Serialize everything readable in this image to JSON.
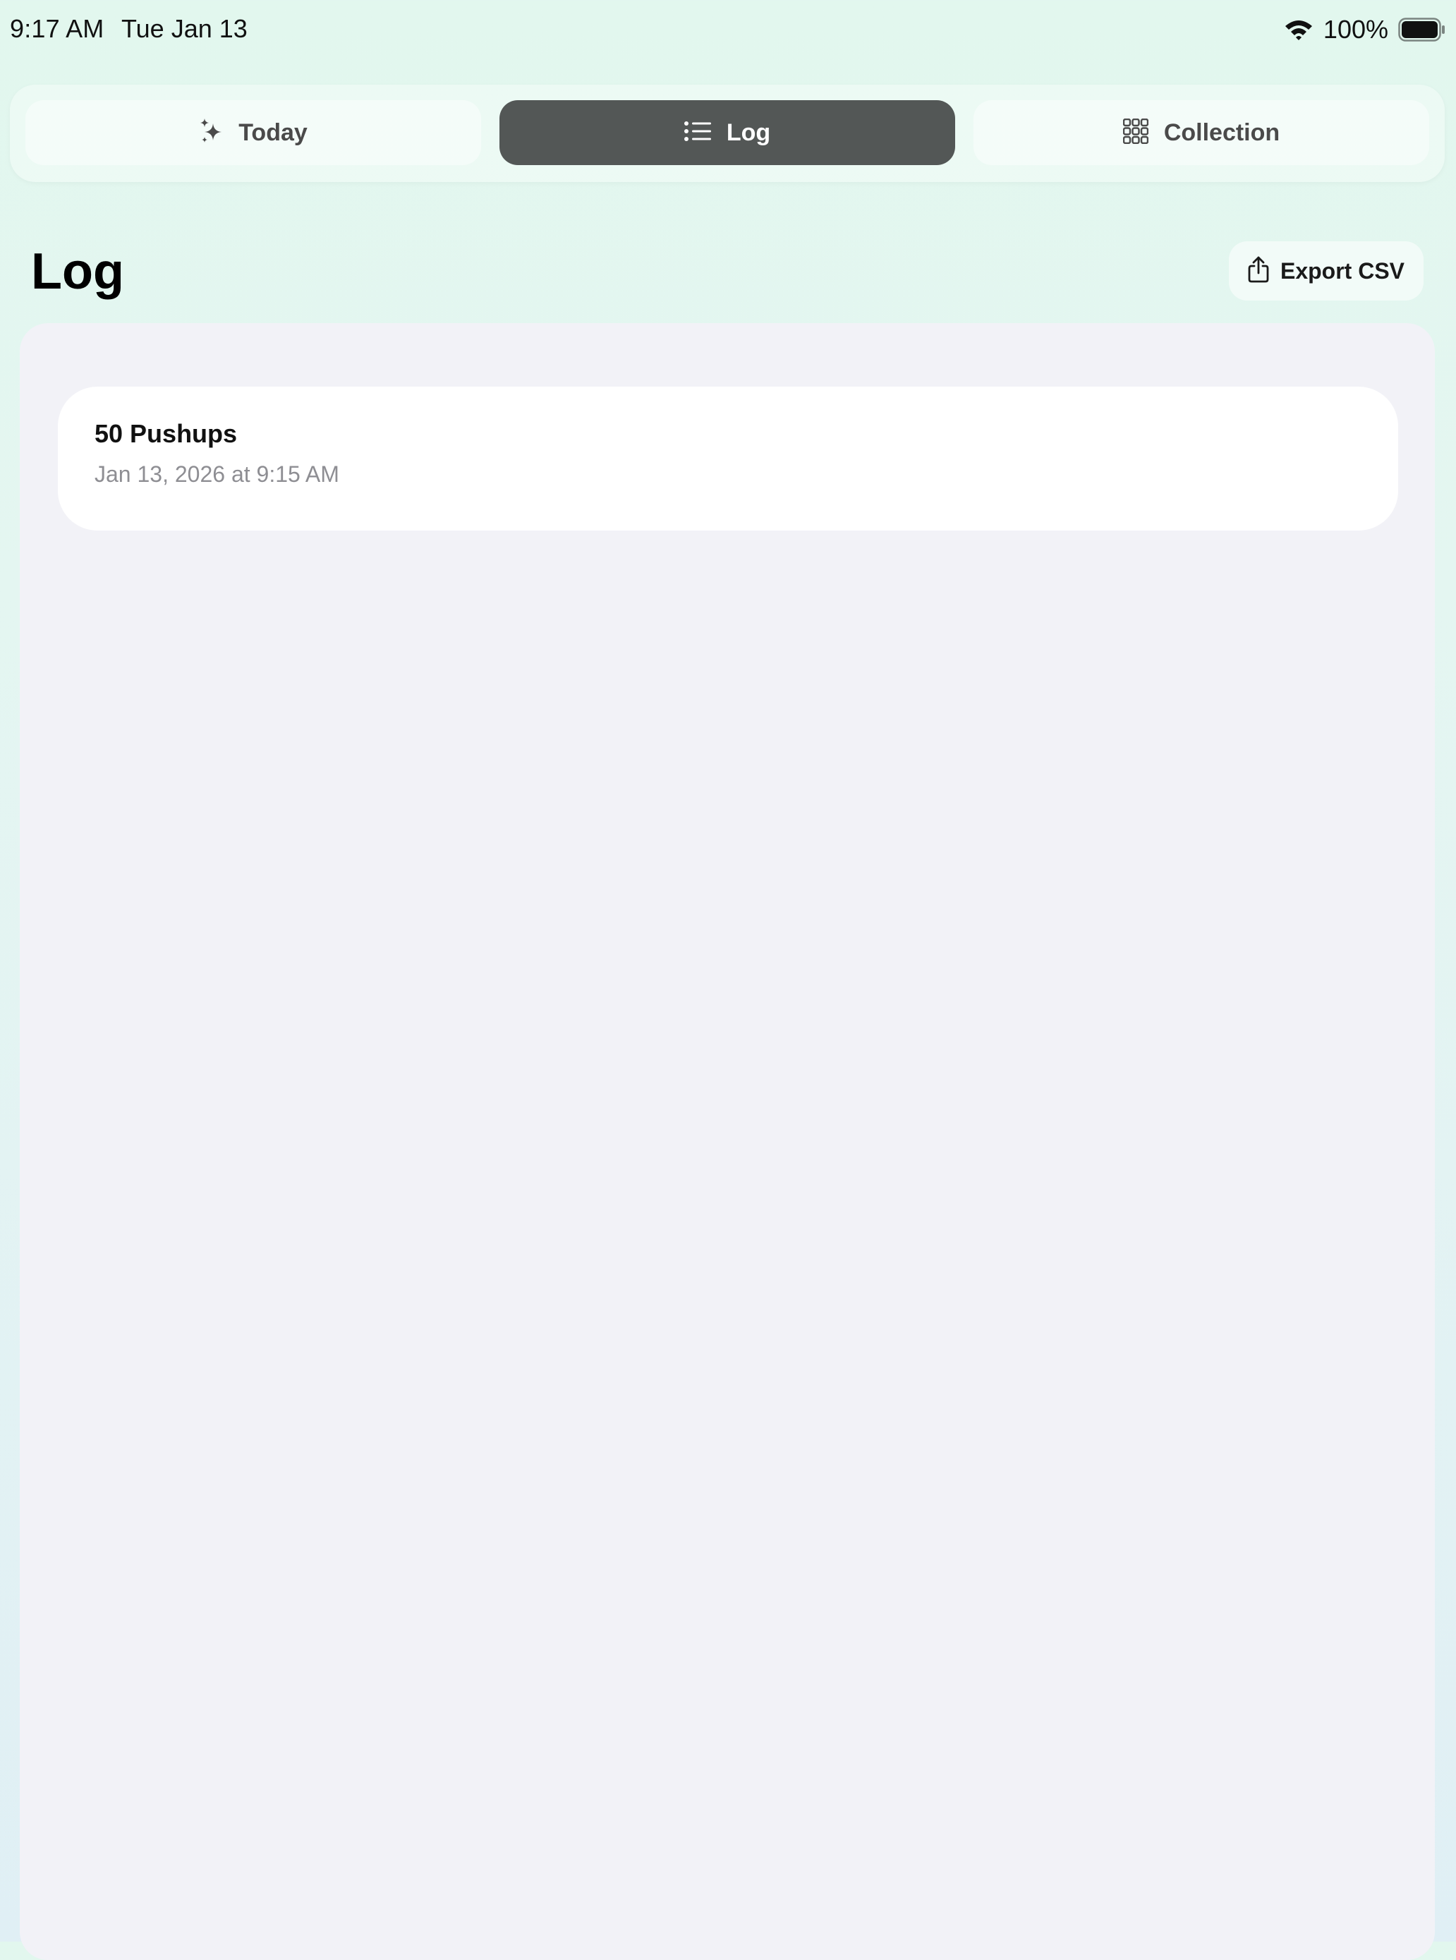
{
  "status_bar": {
    "time": "9:17 AM",
    "date": "Tue Jan 13",
    "battery_percent": "100%",
    "wifi_icon": "wifi-icon",
    "battery_icon": "battery-full-icon"
  },
  "tabs": [
    {
      "label": "Today",
      "icon": "sparkle-icon",
      "selected": false
    },
    {
      "label": "Log",
      "icon": "list-icon",
      "selected": true
    },
    {
      "label": "Collection",
      "icon": "grid-icon",
      "selected": false
    }
  ],
  "header": {
    "title": "Log",
    "export_label": "Export CSV",
    "export_icon": "share-icon"
  },
  "log_entries": [
    {
      "title": "50 Pushups",
      "timestamp": "Jan 13, 2026 at 9:15 AM"
    }
  ],
  "colors": {
    "active_tab": "#535756",
    "panel_background": "#f2f2f7",
    "secondary_text": "#8e8e93"
  }
}
